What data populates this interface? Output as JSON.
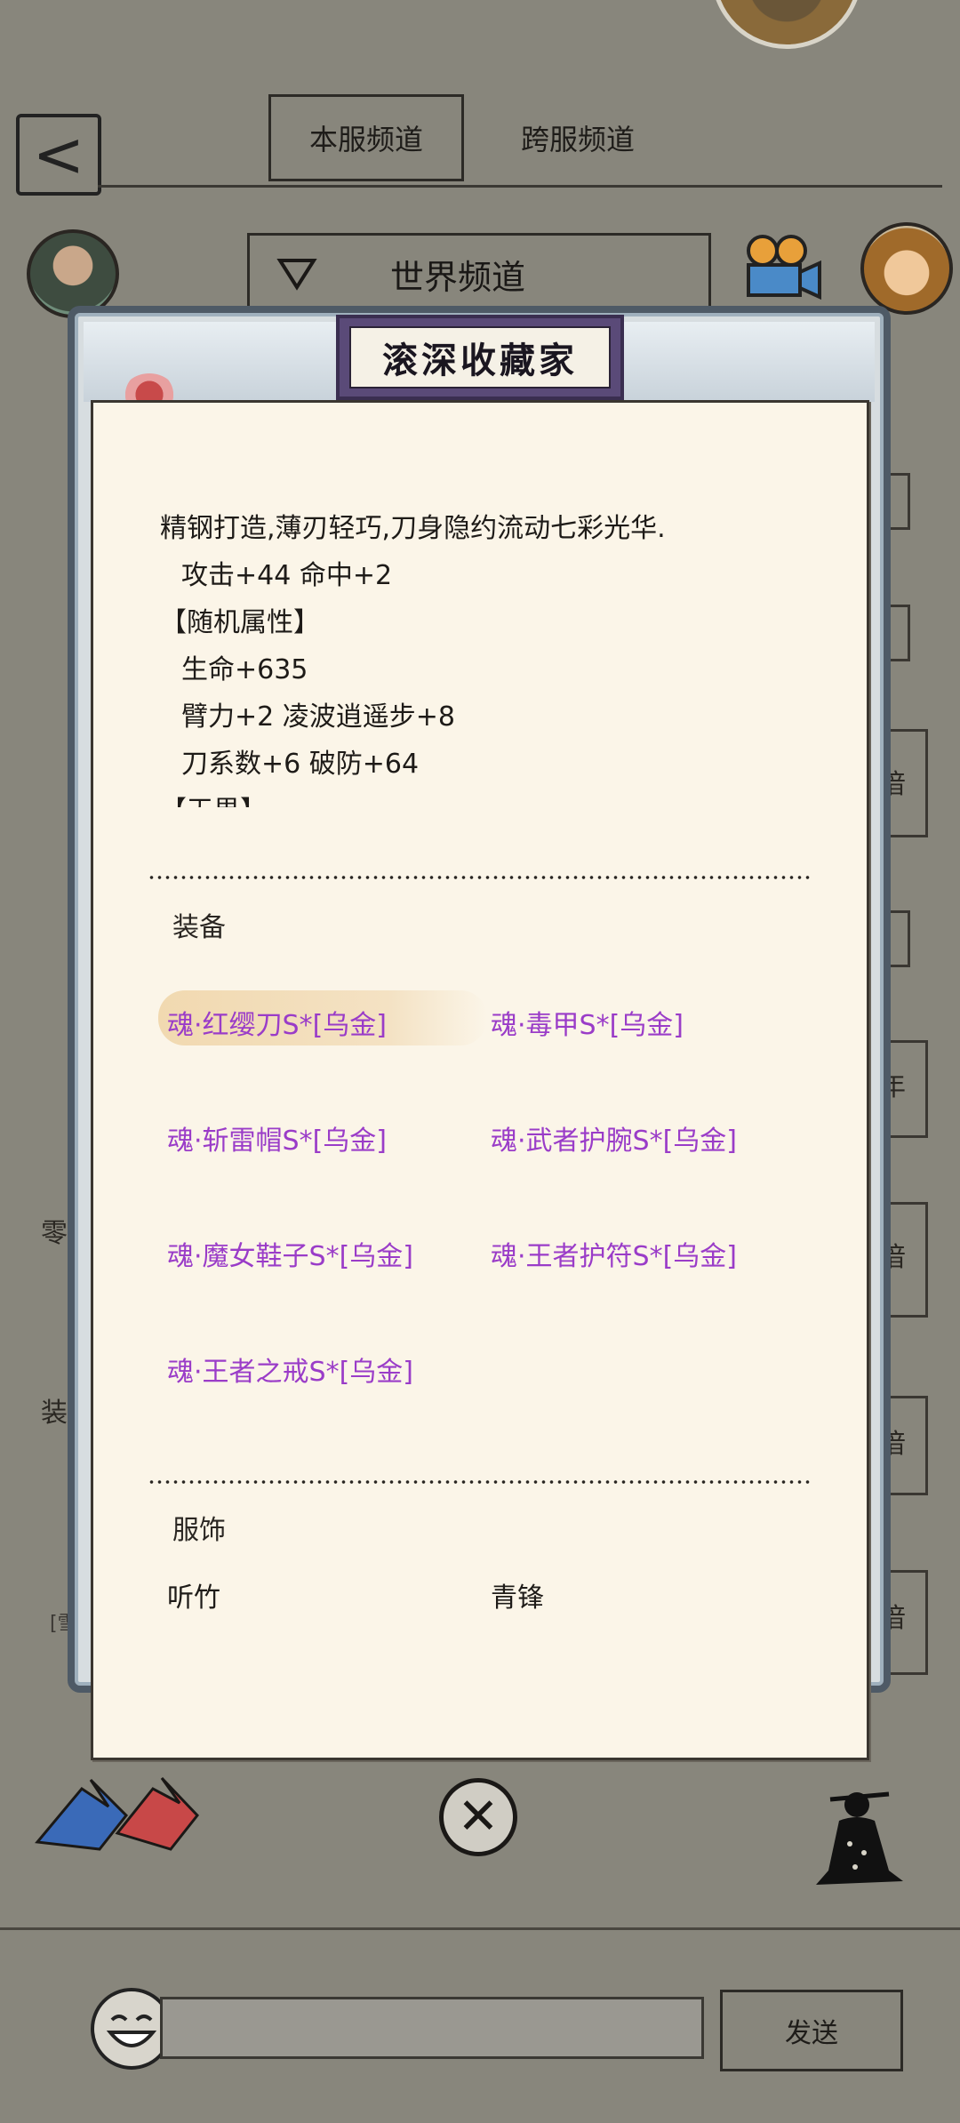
{
  "header": {
    "back_glyph": "<",
    "tabs": [
      {
        "label": "本服频道",
        "active": true
      },
      {
        "label": "跨服频道",
        "active": false
      }
    ]
  },
  "channel": {
    "selected": "世界频道",
    "dropdown_icon": "triangle-down-icon"
  },
  "background_fragments": {
    "left_chars": [
      "零",
      "装"
    ],
    "left_bracket": "[雪",
    "right_chars": [
      "偣",
      "年",
      "偣",
      "偣",
      "偣"
    ]
  },
  "modal": {
    "title": "滚深收藏家",
    "description": [
      "精钢打造,薄刃轻巧,刀身隐约流动七彩光华.",
      "攻击+44 命中+2",
      "【随机属性】",
      "生命+635",
      "臂力+2 凌波逍遥步+8",
      "刀系数+6 破防+64",
      "【天界】"
    ],
    "equipment_section": {
      "label": "装备",
      "items": [
        "魂·红缨刀S*[乌金]",
        "魂·毒甲S*[乌金]",
        "魂·斩雷帽S*[乌金]",
        "魂·武者护腕S*[乌金]",
        "魂·魔女鞋子S*[乌金]",
        "魂·王者护符S*[乌金]",
        "魂·王者之戒S*[乌金]"
      ],
      "item_color": "#9a3cc8"
    },
    "fashion_section": {
      "label": "服饰",
      "items": [
        "听竹",
        "青锋"
      ]
    },
    "close_glyph": "✕"
  },
  "bottom_bar": {
    "send_label": "发送",
    "input_value": ""
  },
  "colors": {
    "background": "#88867c",
    "paper": "#fbf5e8",
    "plaque": "#5a4a78"
  }
}
